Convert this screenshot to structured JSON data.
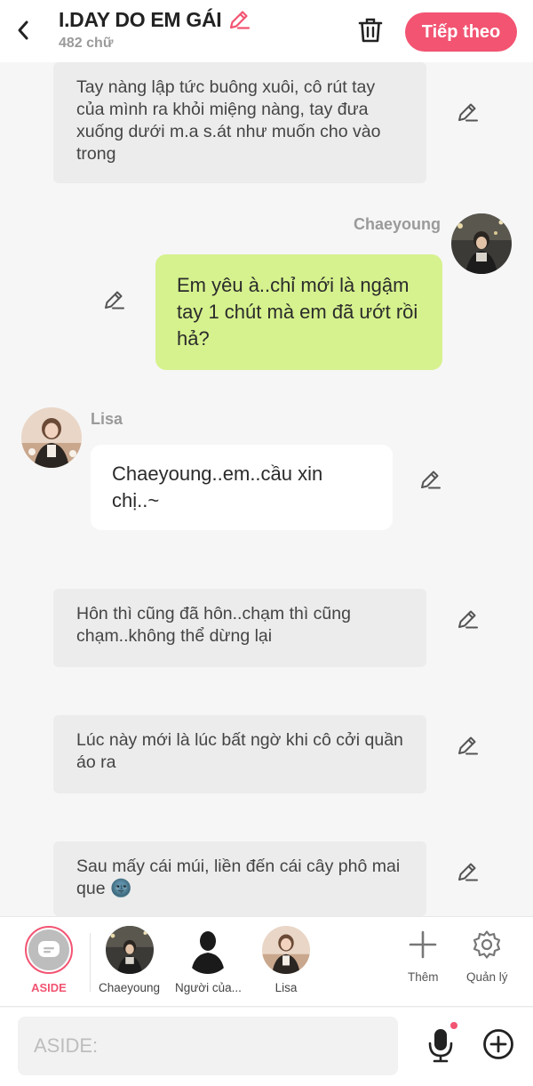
{
  "header": {
    "title": "I.DAY DO EM GÁI",
    "word_count": "482 chữ",
    "next_label": "Tiếp theo",
    "accent_color": "#f25472"
  },
  "messages": [
    {
      "type": "narration",
      "text": "Tay nàng lập tức buông xuôi, cô rút tay của mình ra khỏi miệng nàng, tay đưa xuống dưới m.a s.át như muốn cho vào trong"
    },
    {
      "type": "character",
      "side": "right",
      "name": "Chaeyoung",
      "text": "Em yêu à..chỉ mới là ngậm tay 1 chút mà em đã ướt rồi hả?",
      "bubble_color": "#d6f28e"
    },
    {
      "type": "character",
      "side": "left",
      "name": "Lisa",
      "text": "Chaeyoung..em..cầu xin chị..~",
      "bubble_color": "#ffffff"
    },
    {
      "type": "narration",
      "text": "Hôn thì cũng đã hôn..chạm thì cũng chạm..không thể dừng lại"
    },
    {
      "type": "narration",
      "text": "Lúc này mới là lúc bất ngờ khi cô cởi quần áo ra"
    },
    {
      "type": "narration",
      "text": "Sau mấy cái múi, liền đến cái cây phô mai que 🌚"
    }
  ],
  "character_bar": {
    "items": [
      {
        "label": "ASIDE"
      },
      {
        "label": "Chaeyoung"
      },
      {
        "label": "Người của..."
      },
      {
        "label": "Lisa"
      }
    ],
    "more_label": "Thêm",
    "manage_label": "Quản lý"
  },
  "input": {
    "placeholder": "ASIDE:",
    "value": ""
  },
  "icons": {
    "back": "chevron-left-icon",
    "edit": "pencil-icon",
    "trash": "trash-icon",
    "mic": "microphone-icon",
    "add": "plus-circle-icon",
    "more": "plus-icon",
    "manage": "gear-icon"
  }
}
